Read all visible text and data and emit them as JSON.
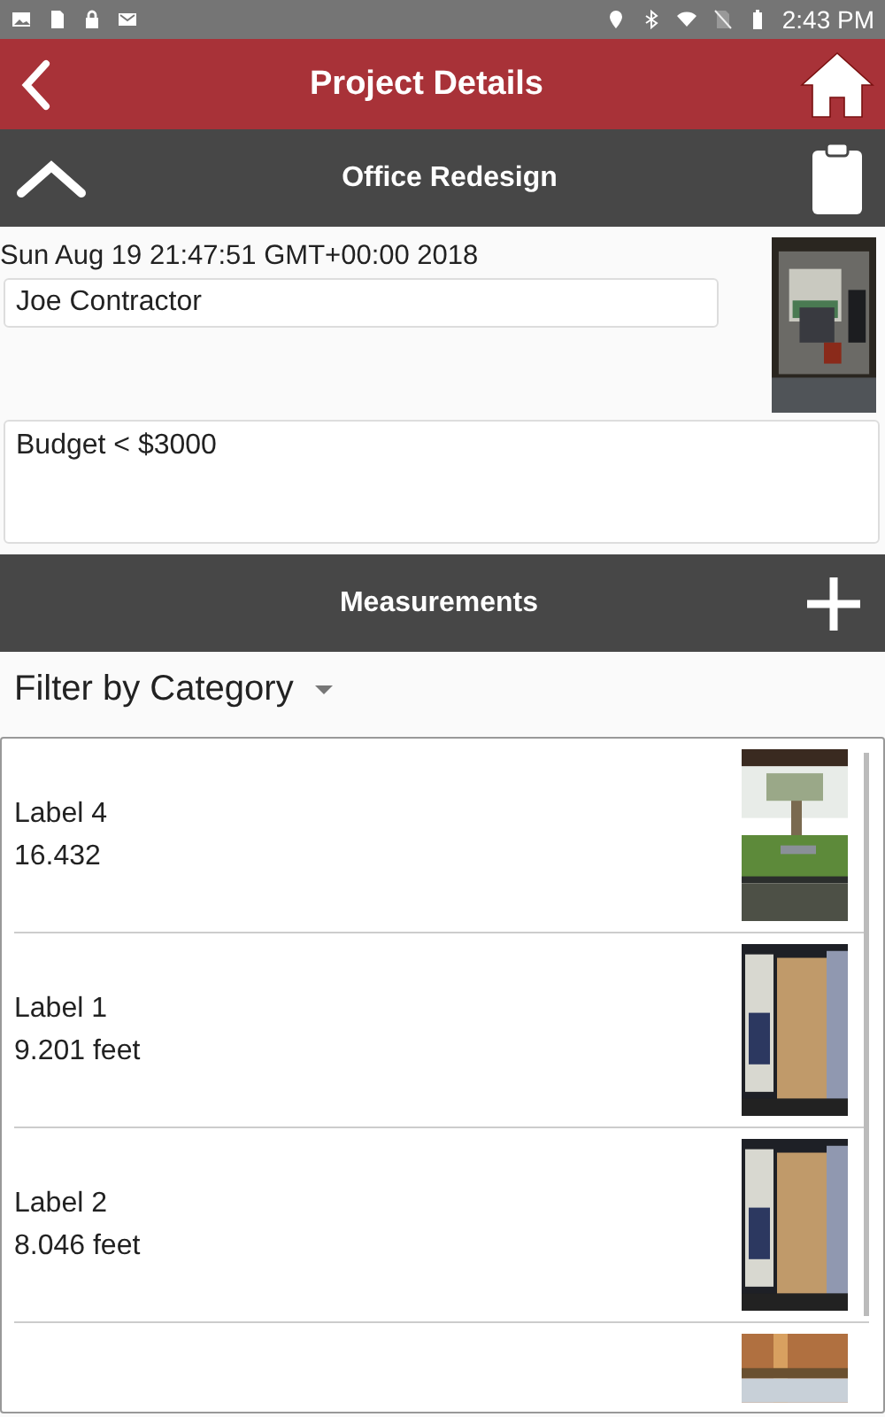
{
  "status_bar": {
    "time": "2:43 PM"
  },
  "app_bar": {
    "title": "Project Details"
  },
  "project_bar": {
    "title": "Office Redesign"
  },
  "project": {
    "date": "Sun Aug 19 21:47:51 GMT+00:00 2018",
    "contractor": "Joe Contractor",
    "notes": "Budget < $3000",
    "photo": {
      "kind": "picture"
    }
  },
  "measurements_bar": {
    "title": "Measurements"
  },
  "filter": {
    "label": "Filter by Category"
  },
  "measurements": [
    {
      "label": "Label 4",
      "value": "16.432",
      "photo": {
        "kind": "picture"
      }
    },
    {
      "label": "Label 1",
      "value": "9.201 feet",
      "photo": {
        "kind": "picture"
      }
    },
    {
      "label": "Label 2",
      "value": "8.046 feet",
      "photo": {
        "kind": "picture"
      }
    },
    {
      "photo": {
        "kind": "picture"
      }
    }
  ]
}
